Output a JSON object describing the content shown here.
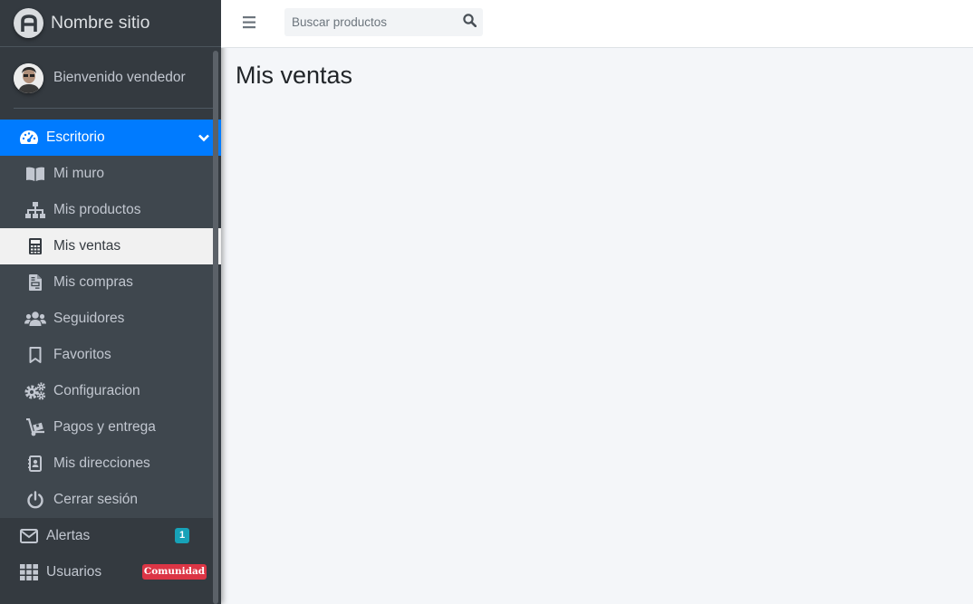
{
  "brand": {
    "name": "Nombre sitio",
    "logo_icon": "brand-logo-icon"
  },
  "user": {
    "welcome": "Bienvenido vendedor"
  },
  "search": {
    "placeholder": "Buscar productos"
  },
  "page": {
    "title": "Mis ventas"
  },
  "colors": {
    "sidebar_bg": "#343a40",
    "active_bg": "#007bff",
    "active_sub_bg": "#f1f1f1",
    "badge_info": "#17a2b8",
    "badge_danger": "#dc3545",
    "content_bg": "#f4f6f9"
  },
  "nav": {
    "escritorio": {
      "label": "Escritorio",
      "icon": "tachometer-icon"
    },
    "sub": [
      {
        "label": "Mi muro",
        "icon": "book-icon"
      },
      {
        "label": "Mis productos",
        "icon": "sitemap-icon"
      },
      {
        "label": "Mis ventas",
        "icon": "calculator-icon",
        "active": true
      },
      {
        "label": "Mis compras",
        "icon": "file-invoice-icon"
      },
      {
        "label": "Seguidores",
        "icon": "users-icon"
      },
      {
        "label": "Favoritos",
        "icon": "bookmark-icon"
      },
      {
        "label": "Configuracion",
        "icon": "cogs-icon"
      },
      {
        "label": "Pagos y entrega",
        "icon": "dolly-icon"
      },
      {
        "label": "Mis direcciones",
        "icon": "address-book-icon"
      },
      {
        "label": "Cerrar sesión",
        "icon": "power-icon"
      }
    ],
    "alertas": {
      "label": "Alertas",
      "badge": "1",
      "icon": "envelope-icon"
    },
    "usuarios": {
      "label": "Usuarios",
      "badge": "Comunidad",
      "icon": "grid-icon"
    }
  }
}
